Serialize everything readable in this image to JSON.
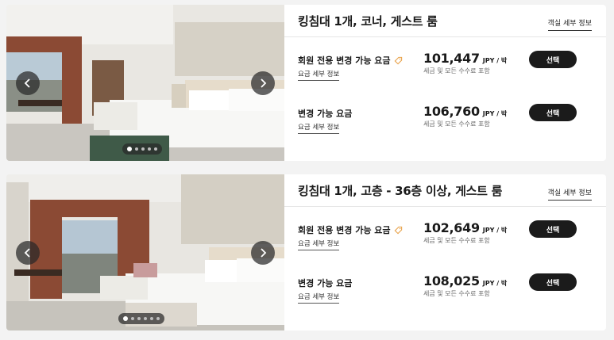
{
  "rooms": [
    {
      "title": "킹침대 1개, 코너, 게스트 룸",
      "detail_link": "객실 세부 정보",
      "photo_dots": 5,
      "rates": [
        {
          "name": "회원 전용 변경 가능 요금",
          "has_member_icon": true,
          "detail_link": "요금 세부 정보",
          "price": "101,447",
          "unit": "JPY / 박",
          "tax_note": "세금 및 모든 수수료 포함",
          "select_label": "선택"
        },
        {
          "name": "변경 가능 요금",
          "has_member_icon": false,
          "detail_link": "요금 세부 정보",
          "price": "106,760",
          "unit": "JPY / 박",
          "tax_note": "세금 및 모든 수수료 포함",
          "select_label": "선택"
        }
      ]
    },
    {
      "title": "킹침대 1개, 고층 - 36층 이상, 게스트 룸",
      "detail_link": "객실 세부 정보",
      "photo_dots": 6,
      "rates": [
        {
          "name": "회원 전용 변경 가능 요금",
          "has_member_icon": true,
          "detail_link": "요금 세부 정보",
          "price": "102,649",
          "unit": "JPY / 박",
          "tax_note": "세금 및 모든 수수료 포함",
          "select_label": "선택"
        },
        {
          "name": "변경 가능 요금",
          "has_member_icon": false,
          "detail_link": "요금 세부 정보",
          "price": "108,025",
          "unit": "JPY / 박",
          "tax_note": "세금 및 모든 수수료 포함",
          "select_label": "선택"
        }
      ]
    }
  ],
  "icons": {
    "prev": "chevron-left-icon",
    "next": "chevron-right-icon",
    "member": "tag-icon"
  },
  "colors": {
    "button_bg": "#1b1b1b",
    "member_icon": "#e8a24a",
    "page_bg": "#f3f3f3"
  }
}
